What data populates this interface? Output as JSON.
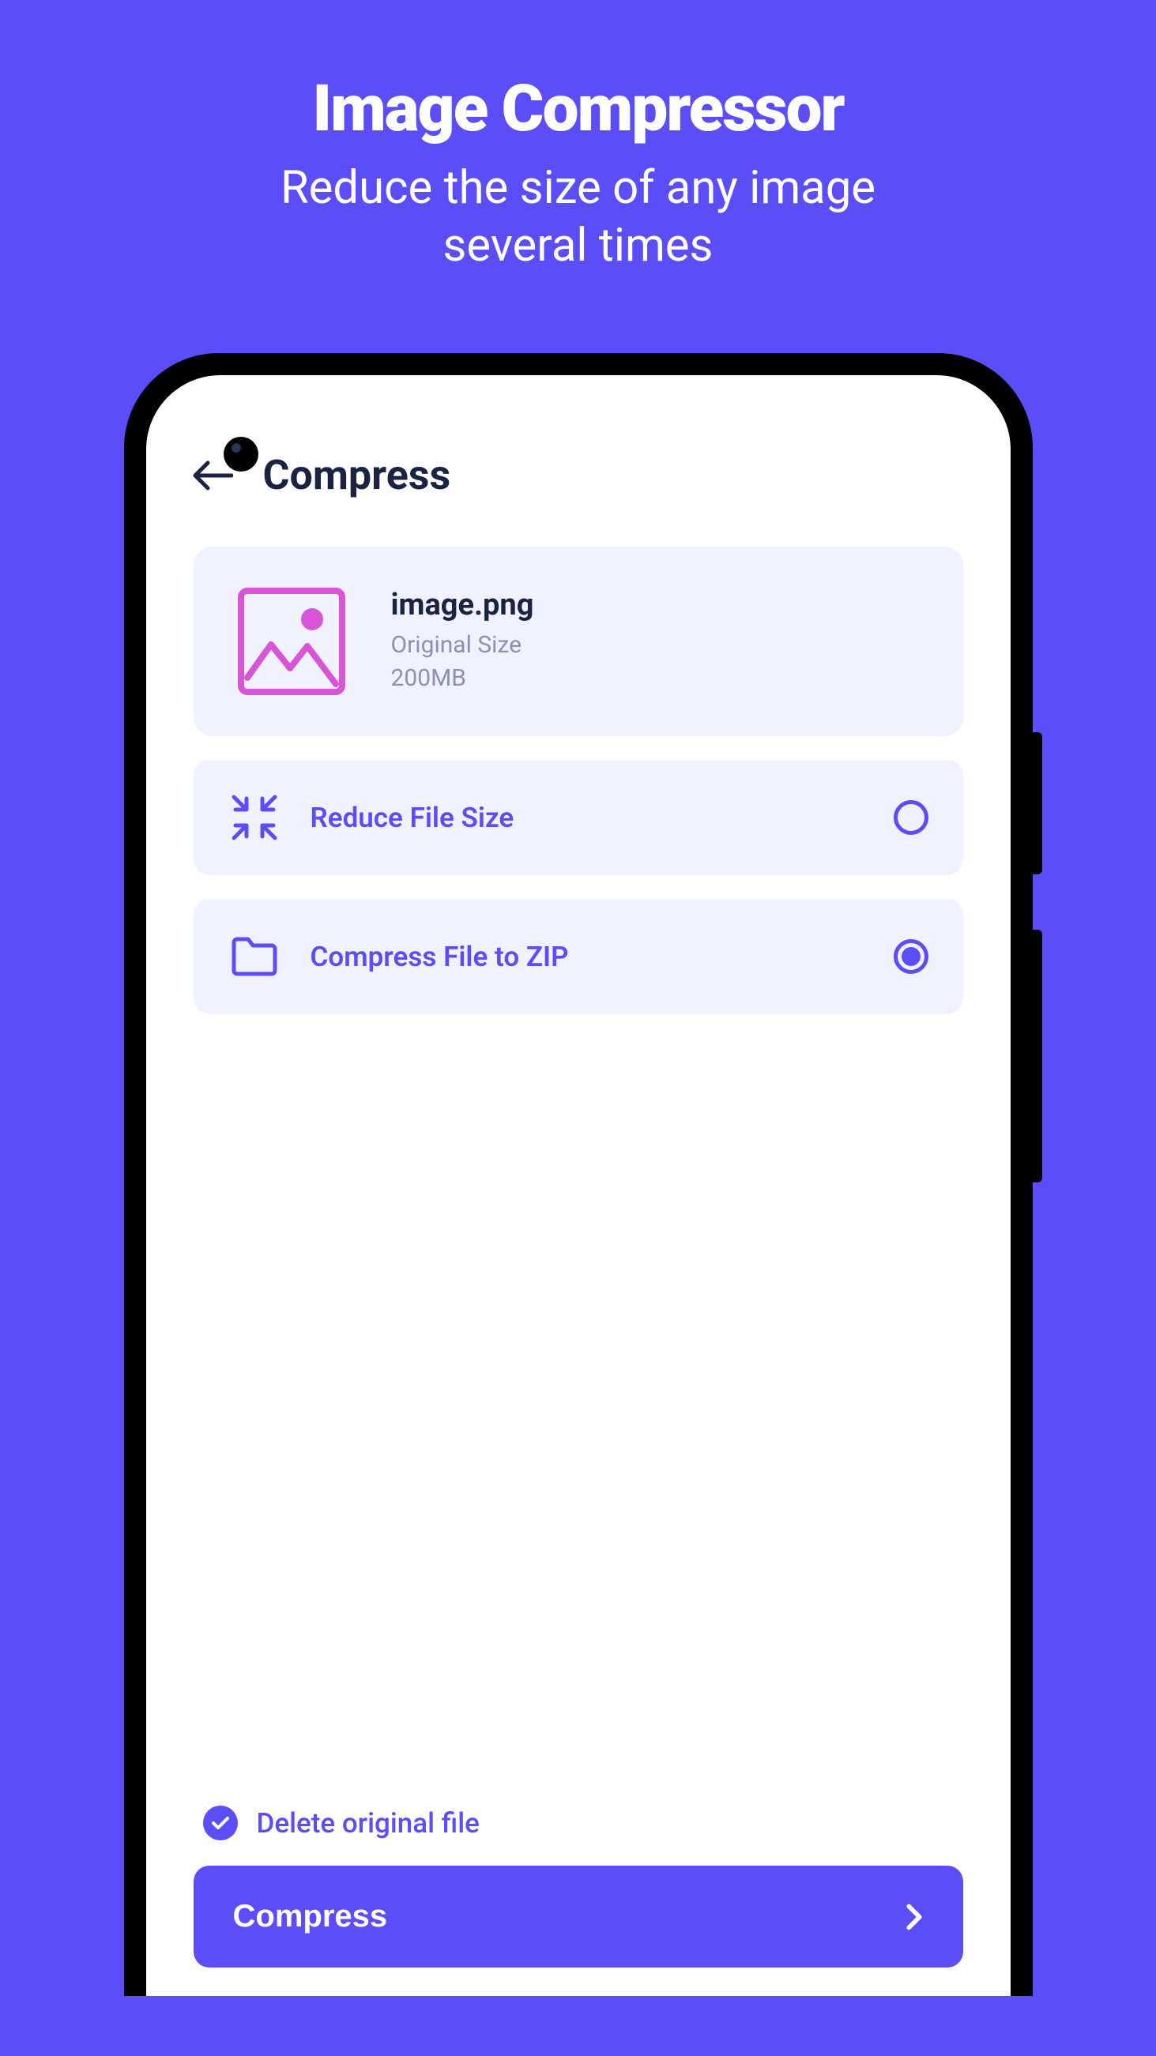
{
  "promo": {
    "title": "Image Compressor",
    "subtitle_line1": "Reduce the size of any image",
    "subtitle_line2": "several times"
  },
  "screen": {
    "title": "Compress",
    "file": {
      "name": "image.png",
      "meta_label": "Original Size",
      "size": "200MB"
    },
    "options": {
      "reduce": {
        "label": "Reduce File Size",
        "selected": false
      },
      "zip": {
        "label": "Compress File to ZIP",
        "selected": true
      }
    },
    "delete_original": {
      "label": "Delete original file",
      "checked": true
    },
    "action_button": "Compress"
  },
  "colors": {
    "primary": "#5b4ef8",
    "dark": "#1a2340",
    "muted": "#8a92b2",
    "card_bg": "#f0f2ff",
    "pink": "#d855d8"
  }
}
